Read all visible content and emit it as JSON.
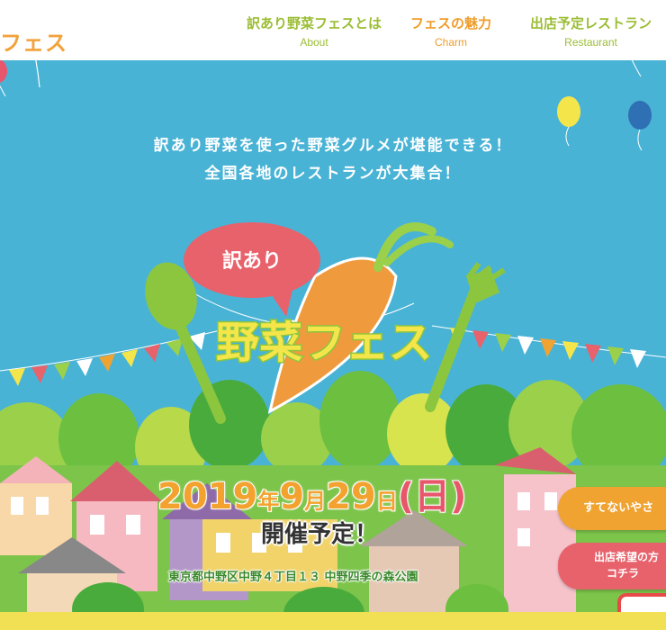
{
  "header": {
    "logo_text": "フェス",
    "nav": [
      {
        "ja": "訳あり野菜フェスとは",
        "en": "About"
      },
      {
        "ja": "フェスの魅力",
        "en": "Charm"
      },
      {
        "ja": "出店予定レストラン",
        "en": "Restaurant"
      }
    ]
  },
  "hero": {
    "tagline_1": "訳あり野菜を使った野菜グルメが堪能できる！",
    "tagline_2": "全国各地のレストランが大集合！",
    "bubble_text": "訳あり",
    "title_text": "野菜フェス",
    "date": {
      "year": "2019",
      "year_unit": "年",
      "month": "9",
      "month_unit": "月",
      "day": "29",
      "day_unit": "日",
      "weekday": "(日)"
    },
    "holding": "開催予定！",
    "address": "東京都中野区中野４丁目１３ 中野四季の森公園"
  },
  "side_buttons": {
    "vegetable": "すてないやさ",
    "apply_line1": "出店希望の方",
    "apply_line2": "コチラ"
  },
  "colors": {
    "sky": "#49b3d6",
    "accent_orange": "#f0a331",
    "accent_green": "#9bbd34",
    "accent_pink": "#e8626c"
  }
}
